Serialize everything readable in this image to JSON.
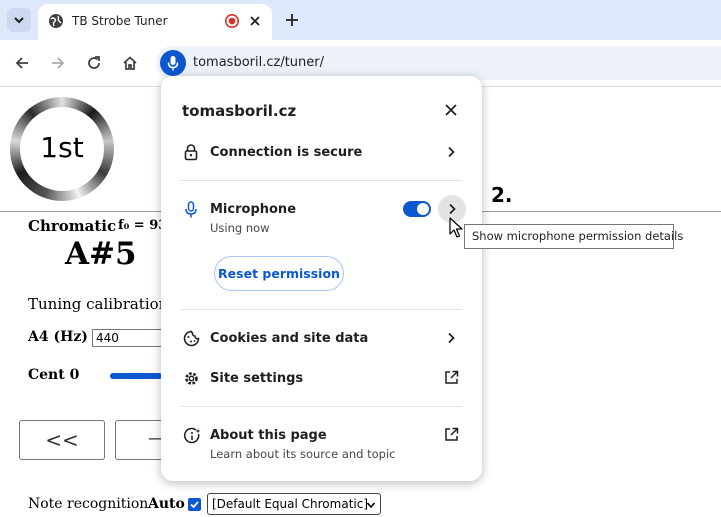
{
  "browser": {
    "tab_title": "TB Strobe Tuner",
    "url": "tomasboril.cz/tuner/"
  },
  "page": {
    "ordinal": "1st",
    "mode_label": "Chromatic",
    "freq_label": "f₀ = 93",
    "note": "A#5",
    "calibration_heading": "Tuning calibration",
    "a4_label": "A4 (Hz)",
    "a4_value": "440",
    "cent_label": "Cent 0",
    "prev_button": "<<",
    "second_button": "—",
    "recognition_label": "Note recognition",
    "auto_label": "Auto",
    "temperament_value": "[Default Equal Chromatic]"
  },
  "popup": {
    "site": "tomasboril.cz",
    "connection": "Connection is secure",
    "microphone": "Microphone",
    "microphone_status": "Using now",
    "microphone_enabled": true,
    "reset_button": "Reset permission",
    "cookies": "Cookies and site data",
    "site_settings": "Site settings",
    "about_title": "About this page",
    "about_sub": "Learn about its source and topic"
  },
  "tooltip": "Show microphone permission details",
  "annotation": "2.",
  "colors": {
    "accent": "#0b57d0",
    "tab_strip": "#dee8fb",
    "omnibox": "#edf2fa",
    "record_red": "#d93025"
  }
}
